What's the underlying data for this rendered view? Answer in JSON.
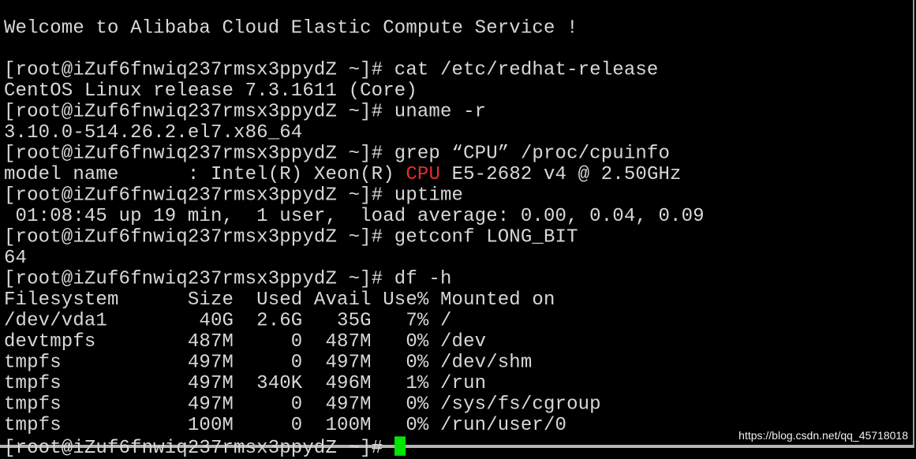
{
  "terminal": {
    "lines": [
      [
        {
          "text": "Welcome to Alibaba Cloud Elastic Compute Service !"
        }
      ],
      [
        {
          "text": ""
        }
      ],
      [
        {
          "text": "[root@iZuf6fnwiq237rmsx3ppydZ ~]# cat /etc/redhat-release"
        }
      ],
      [
        {
          "text": "CentOS Linux release 7.3.1611 (Core)"
        }
      ],
      [
        {
          "text": "[root@iZuf6fnwiq237rmsx3ppydZ ~]# uname -r"
        }
      ],
      [
        {
          "text": "3.10.0-514.26.2.el7.x86_64"
        }
      ],
      [
        {
          "text": "[root@iZuf6fnwiq237rmsx3ppydZ ~]# grep “CPU” /proc/cpuinfo"
        }
      ],
      [
        {
          "text": "model name      : Intel(R) Xeon(R) "
        },
        {
          "text": "CPU",
          "color": "#e0302c"
        },
        {
          "text": " E5-2682 v4 @ 2.50GHz"
        }
      ],
      [
        {
          "text": "[root@iZuf6fnwiq237rmsx3ppydZ ~]# uptime"
        }
      ],
      [
        {
          "text": " 01:08:45 up 19 min,  1 user,  load average: 0.00, 0.04, 0.09"
        }
      ],
      [
        {
          "text": "[root@iZuf6fnwiq237rmsx3ppydZ ~]# getconf LONG_BIT"
        }
      ],
      [
        {
          "text": "64"
        }
      ],
      [
        {
          "text": "[root@iZuf6fnwiq237rmsx3ppydZ ~]# df -h"
        }
      ],
      [
        {
          "text": "Filesystem      Size  Used Avail Use% Mounted on"
        }
      ],
      [
        {
          "text": "/dev/vda1        40G  2.6G   35G   7% /"
        }
      ],
      [
        {
          "text": "devtmpfs        487M     0  487M   0% /dev"
        }
      ],
      [
        {
          "text": "tmpfs           497M     0  497M   0% /dev/shm"
        }
      ],
      [
        {
          "text": "tmpfs           497M  340K  496M   1% /run"
        }
      ],
      [
        {
          "text": "tmpfs           497M     0  497M   0% /sys/fs/cgroup"
        }
      ],
      [
        {
          "text": "tmpfs           100M     0  100M   0% /run/user/0"
        }
      ],
      [
        {
          "text": "[root@iZuf6fnwiq237rmsx3ppydZ ~]# "
        }
      ]
    ],
    "cursor_color": "#00e600",
    "text_color": "#d8d8d8",
    "background": "#000000"
  },
  "watermark": "https://blog.csdn.net/qq_45718018"
}
